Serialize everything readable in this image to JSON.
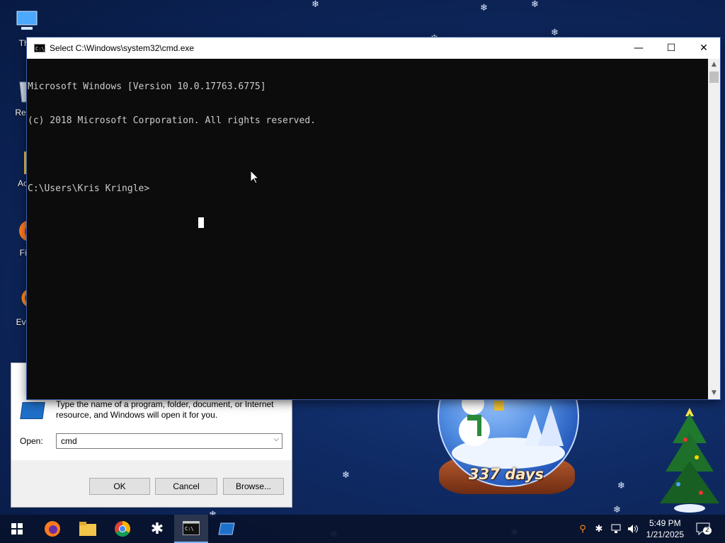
{
  "desktop": {
    "icons": [
      {
        "label": "This",
        "icon": "computer-icon"
      },
      {
        "label": "Recyc",
        "icon": "recycle-bin-icon"
      },
      {
        "label": "Activ",
        "icon": "folder-icon"
      },
      {
        "label": "Fire",
        "icon": "firefox-icon"
      },
      {
        "label": "Every",
        "icon": "everything-search-icon"
      }
    ],
    "snow_globe_text": "337 days"
  },
  "cmd_window": {
    "title": "Select C:\\Windows\\system32\\cmd.exe",
    "lines": [
      "Microsoft Windows [Version 10.0.17763.6775]",
      "(c) 2018 Microsoft Corporation. All rights reserved.",
      "",
      "C:\\Users\\Kris Kringle>"
    ],
    "buttons": {
      "minimize": "—",
      "maximize": "☐",
      "close": "✕"
    }
  },
  "run_dialog": {
    "description": "Type the name of a program, folder, document, or Internet resource, and Windows will open it for you.",
    "open_label": "Open:",
    "open_value": "cmd",
    "ok_label": "OK",
    "cancel_label": "Cancel",
    "browse_label": "Browse..."
  },
  "taskbar": {
    "apps": [
      "start-icon",
      "firefox-icon",
      "file-explorer-icon",
      "chrome-icon",
      "snowflake-app-icon",
      "cmd-icon",
      "run-icon"
    ],
    "time": "5:49 PM",
    "date": "1/21/2025",
    "notification_count": "2",
    "accent": "#7fb2ff"
  }
}
